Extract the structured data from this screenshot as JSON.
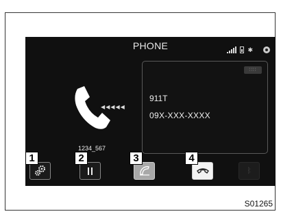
{
  "screen": {
    "title": "PHONE",
    "status": {
      "signal_icon": "signal-bars-icon",
      "battery_icon": "battery-icon",
      "bluetooth_icon": "bluetooth-icon",
      "disc_icon": "disc-icon"
    },
    "panel": {
      "menu_icon": "keypad-icon",
      "caller_name": "911T",
      "caller_number": "09X-XXX-XXXX"
    },
    "call": {
      "handset_icon": "phone-handset-icon",
      "timer": "1234_567"
    },
    "buttons": [
      {
        "id": "settings",
        "icon": "gears-icon",
        "badge": "1"
      },
      {
        "id": "hold",
        "icon": "pause-icon",
        "badge": "2"
      },
      {
        "id": "answer",
        "icon": "phone-answer-icon",
        "badge": "3"
      },
      {
        "id": "hangup",
        "icon": "phone-hangup-icon",
        "badge": "4"
      },
      {
        "id": "bluetooth",
        "icon": "bluetooth-icon",
        "badge": ""
      }
    ]
  },
  "figure_ref": "S01265",
  "colors": {
    "screen_bg": "#101010",
    "text": "#f0f0f0",
    "button_border": "#888888",
    "answer_button": "#a8a8a8",
    "hangup_button": "#f2f2f2"
  }
}
